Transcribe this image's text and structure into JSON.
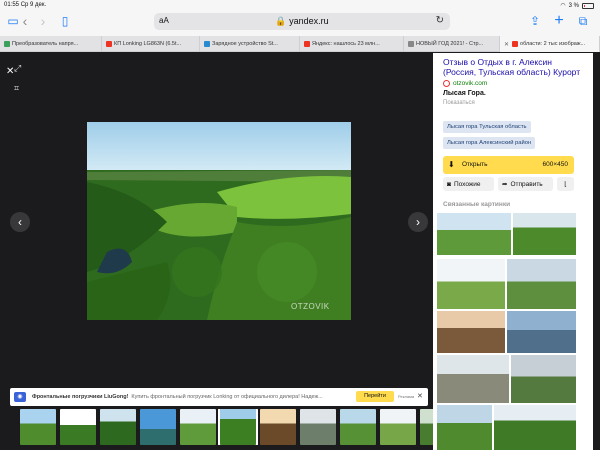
{
  "status": {
    "time": "01:55",
    "date": "Ср 9 дек.",
    "battery": "3 %"
  },
  "toolbar": {
    "aa": "аА",
    "url": "yandex.ru"
  },
  "tabs": [
    {
      "label": "Преобразователь напря...",
      "color": "#3aa05a"
    },
    {
      "label": "КП Lonking LG863N (6.5t...",
      "color": "#e32"
    },
    {
      "label": "Зарядное устройство St...",
      "color": "#2a8ad0"
    },
    {
      "label": "Яндекс: нашлось 23 млн...",
      "color": "#e32"
    },
    {
      "label": "НОВЫЙ ГОД 2021! - Стр...",
      "color": "#888"
    },
    {
      "label": "области: 2 тыс изображ...",
      "color": "#e32"
    }
  ],
  "ad": {
    "title": "Фронтальные погрузчики LiuGong!",
    "text": "Купить фронтальный погрузчик Lonking от официального дилера! Надеж...",
    "button": "Перейти",
    "label": "Реклама"
  },
  "watermark": "OTZOVIK",
  "panel": {
    "title": "Отзыв о Отдых в г. Алексин (Россия, Тульская область) Курорт",
    "source": "otzovik.com",
    "description": "Лысая Гора.",
    "more": "Показаться",
    "chips": [
      "Лысая гора Тульская область",
      "Лысая гора Алексинский район"
    ],
    "open_label": "Открыть",
    "size": "600×450",
    "similar_label": "Похожие",
    "send_label": "Отправить",
    "related_title": "Связанные картинки"
  }
}
